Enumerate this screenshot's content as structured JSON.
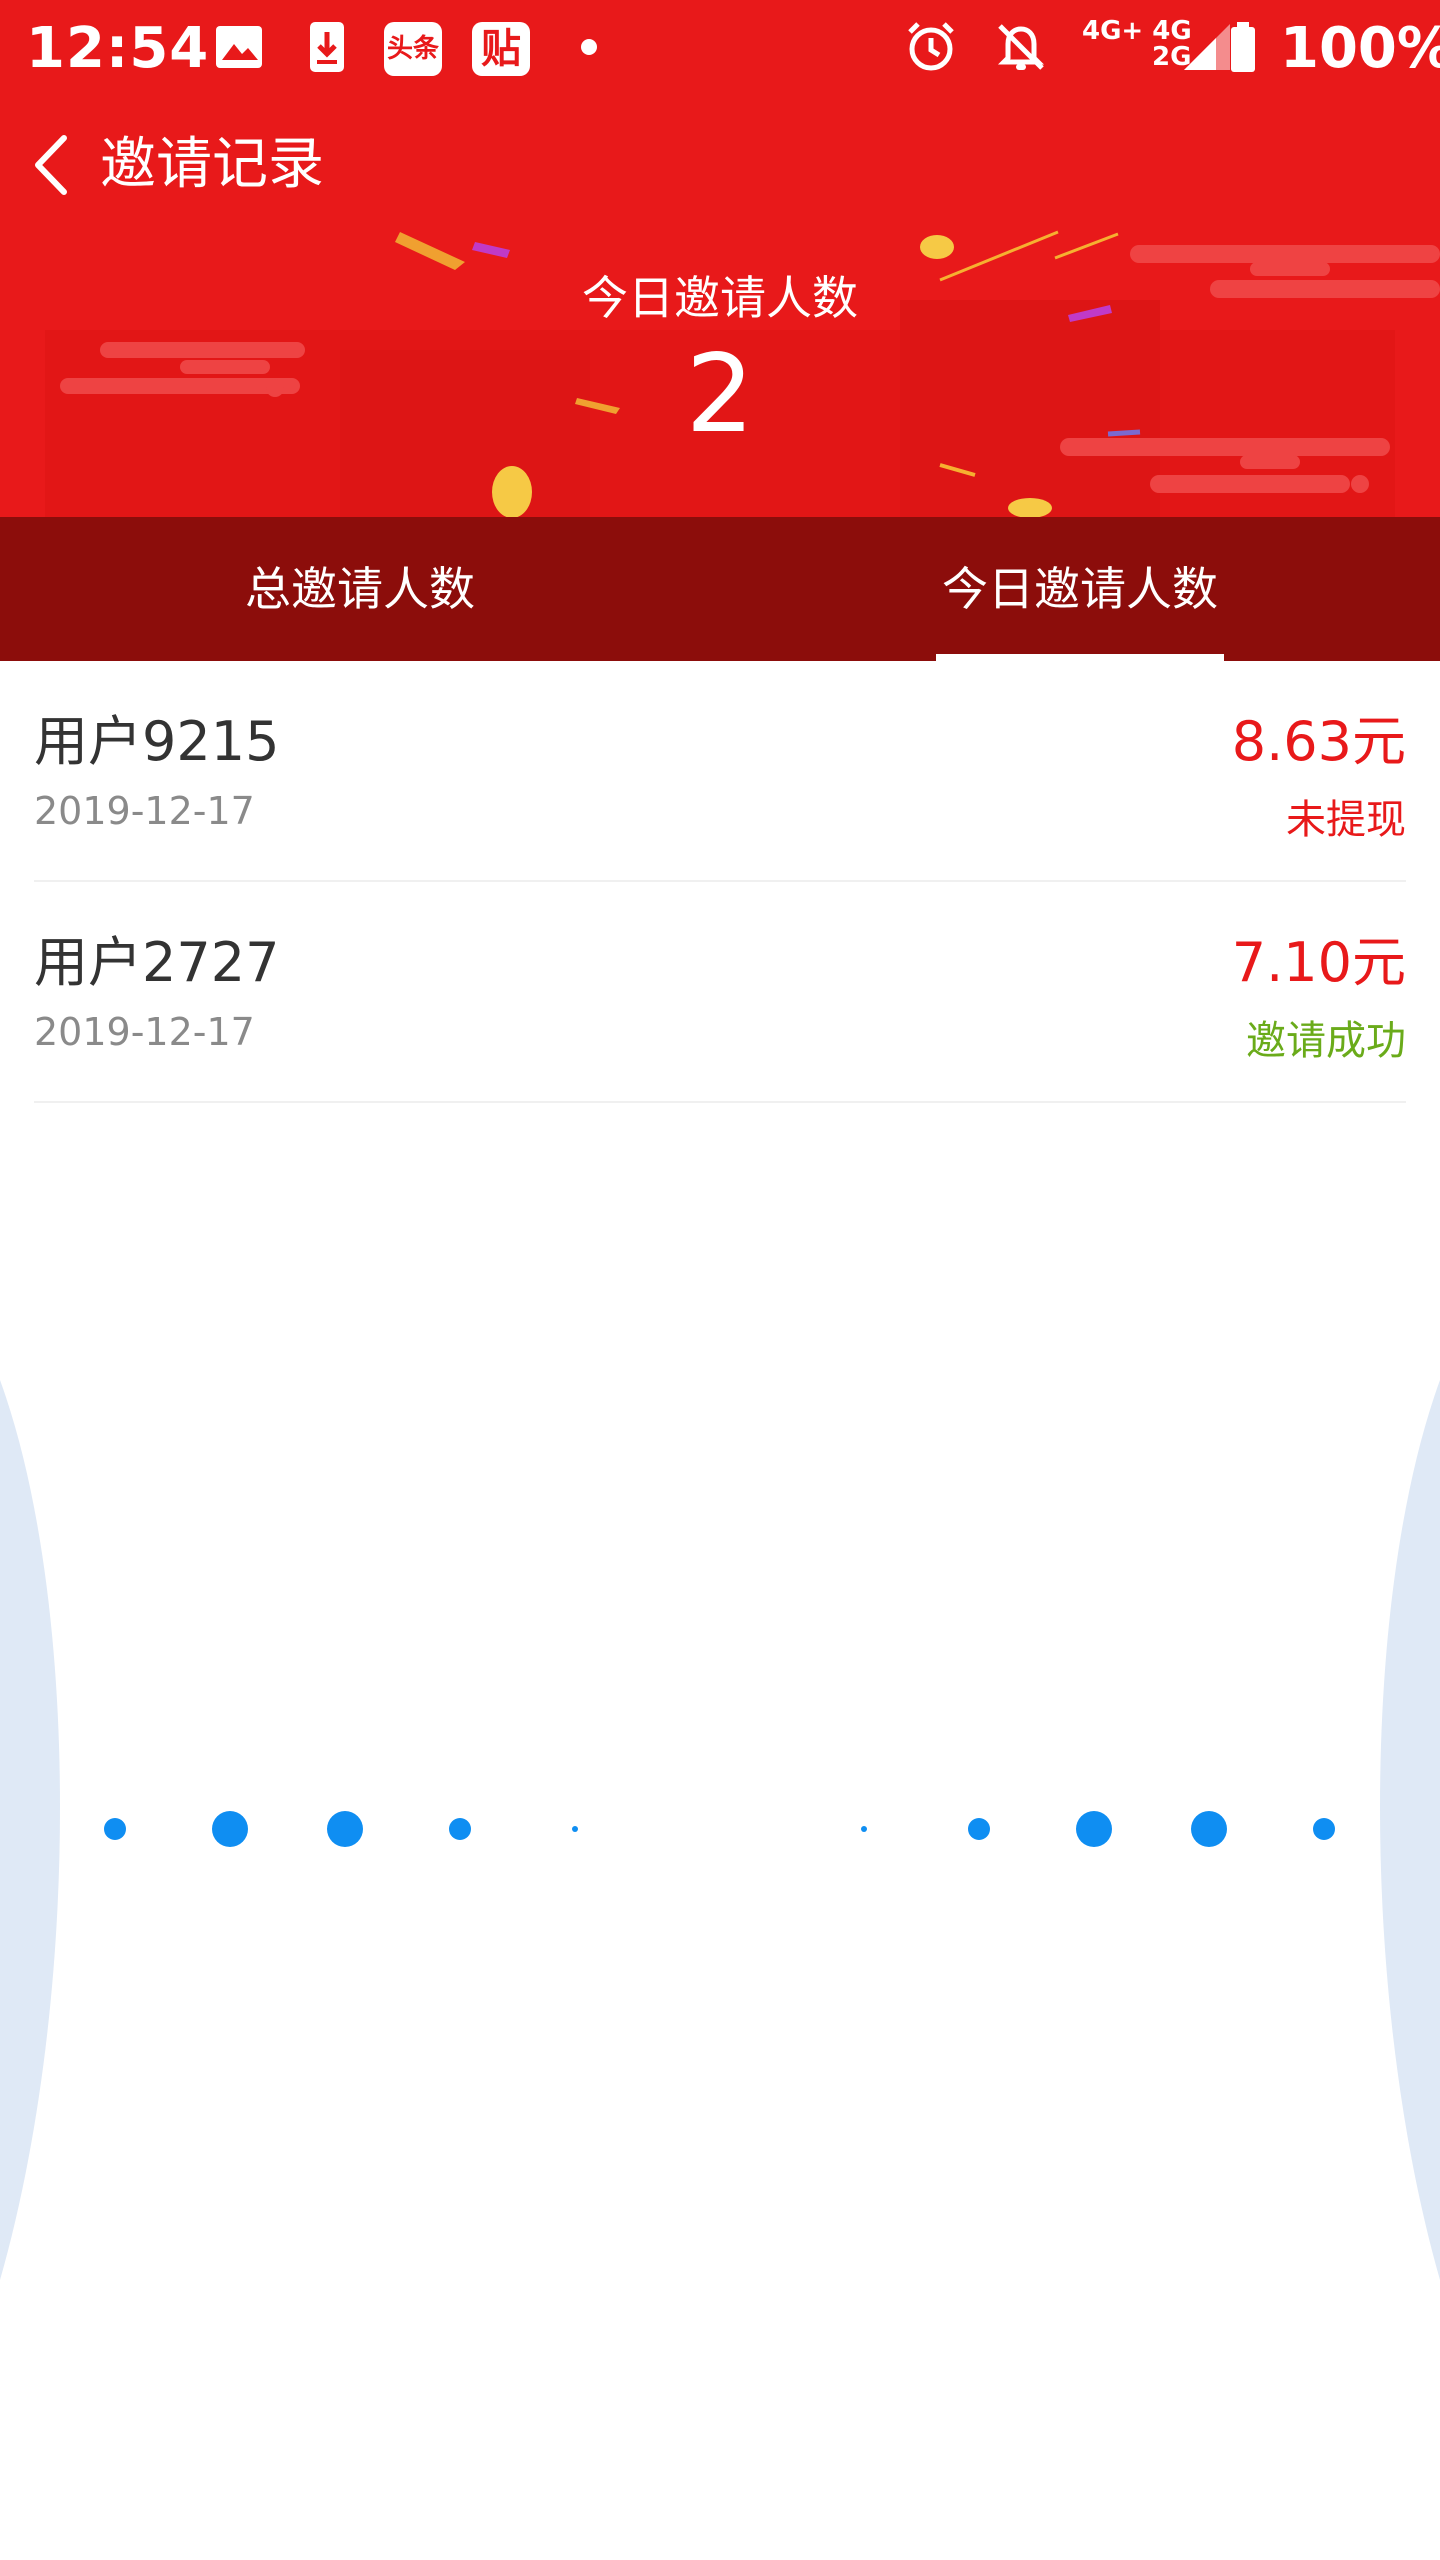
{
  "status_bar": {
    "time": "12:54",
    "icons": [
      "gallery-icon",
      "download-icon",
      "toutiao-app-icon",
      "tieba-app-icon",
      "dot-icon",
      "alarm-icon",
      "mute-icon",
      "signal-icon",
      "battery-icon"
    ],
    "toutiao_label": "头条",
    "tieba_label": "贴",
    "network_top": "4G+ 4G",
    "network_bottom": "2G",
    "battery": "100%"
  },
  "nav": {
    "back_icon": "chevron-left-icon",
    "title": "邀请记录"
  },
  "hero": {
    "label": "今日邀请人数",
    "count": "2"
  },
  "tabs": [
    {
      "label": "总邀请人数",
      "active": false
    },
    {
      "label": "今日邀请人数",
      "active": true
    }
  ],
  "records": [
    {
      "name": "用户9215",
      "date": "2019-12-17",
      "amount": "8.63元",
      "status": "未提现",
      "status_color": "#e8191a"
    },
    {
      "name": "用户2727",
      "date": "2019-12-17",
      "amount": "7.10元",
      "status": "邀请成功",
      "status_color": "#6aab1a"
    }
  ],
  "colors": {
    "brand_red": "#e8191a",
    "tab_bar": "#8c0d0b",
    "loader_dot": "#0f8ef2"
  }
}
